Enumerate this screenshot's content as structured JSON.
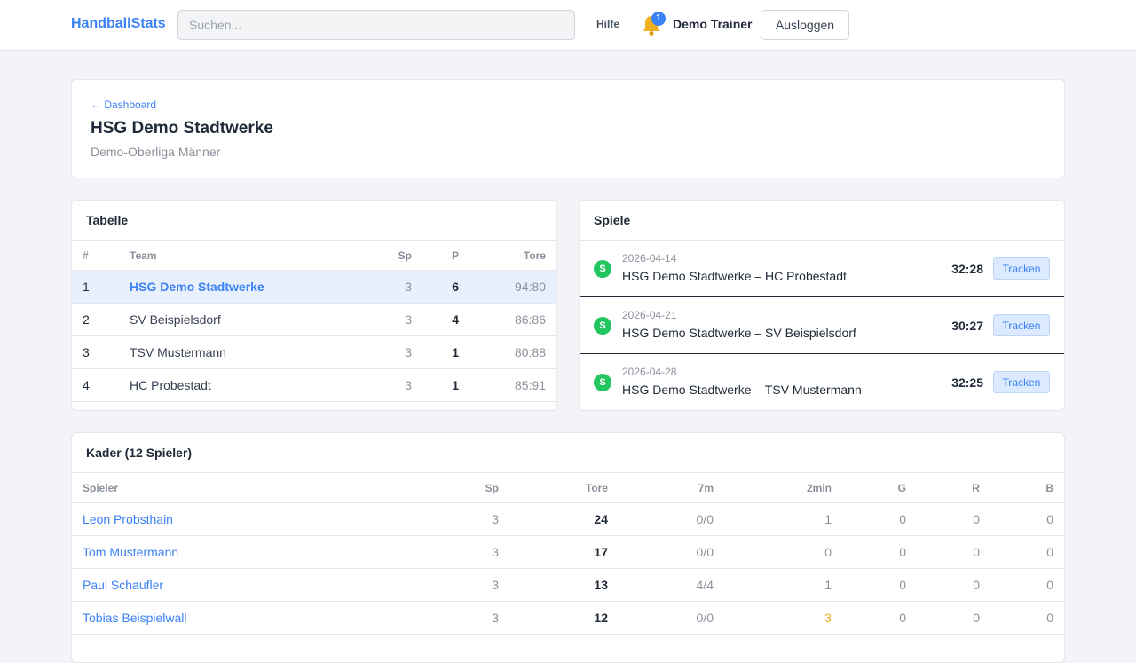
{
  "header": {
    "brand": "HandballStats",
    "search_placeholder": "Suchen...",
    "help": "Hilfe",
    "notification_count": "1",
    "user": "Demo Trainer",
    "logout": "Ausloggen"
  },
  "team": {
    "breadcrumb": "← Dashboard",
    "name": "HSG Demo Stadtwerke",
    "league": "Demo-Oberliga Männer"
  },
  "standings": {
    "title": "Tabelle",
    "columns": [
      "#",
      "Team",
      "Sp",
      "P",
      "Tore"
    ],
    "rows": [
      {
        "pos": "1",
        "team": "HSG Demo Stadtwerke",
        "sp": "3",
        "p": "6",
        "tore": "94:80"
      },
      {
        "pos": "2",
        "team": "SV Beispielsdorf",
        "sp": "3",
        "p": "4",
        "tore": "86:86"
      },
      {
        "pos": "3",
        "team": "TSV Mustermann",
        "sp": "3",
        "p": "1",
        "tore": "80:88"
      },
      {
        "pos": "4",
        "team": "HC Probestadt",
        "sp": "3",
        "p": "1",
        "tore": "85:91"
      }
    ]
  },
  "games": {
    "title": "Spiele",
    "status_badge": "S",
    "track_label": "Tracken",
    "items": [
      {
        "date": "2026-04-14",
        "match": "HSG Demo Stadtwerke – HC Probestadt",
        "score": "32:28"
      },
      {
        "date": "2026-04-21",
        "match": "HSG Demo Stadtwerke – SV Beispielsdorf",
        "score": "30:27"
      },
      {
        "date": "2026-04-28",
        "match": "HSG Demo Stadtwerke – TSV Mustermann",
        "score": "32:25"
      }
    ]
  },
  "roster": {
    "title": "Kader (12 Spieler)",
    "columns": [
      "Spieler",
      "Sp",
      "Tore",
      "7m",
      "2min",
      "G",
      "R",
      "B"
    ],
    "rows": [
      {
        "name": "Leon Probsthain",
        "sp": "3",
        "tore": "24",
        "m7": "0/0",
        "min2": "1",
        "g": "0",
        "r": "0",
        "b": "0"
      },
      {
        "name": "Tom Mustermann",
        "sp": "3",
        "tore": "17",
        "m7": "0/0",
        "min2": "0",
        "g": "0",
        "r": "0",
        "b": "0"
      },
      {
        "name": "Paul Schaufler",
        "sp": "3",
        "tore": "13",
        "m7": "4/4",
        "min2": "1",
        "g": "0",
        "r": "0",
        "b": "0"
      },
      {
        "name": "Tobias Beispielwall",
        "sp": "3",
        "tore": "12",
        "m7": "0/0",
        "min2": "3",
        "g": "0",
        "r": "0",
        "b": "0"
      }
    ]
  },
  "colors": {
    "accent": "#3b82f6",
    "success": "#22c55e",
    "warning": "#f0b020"
  }
}
